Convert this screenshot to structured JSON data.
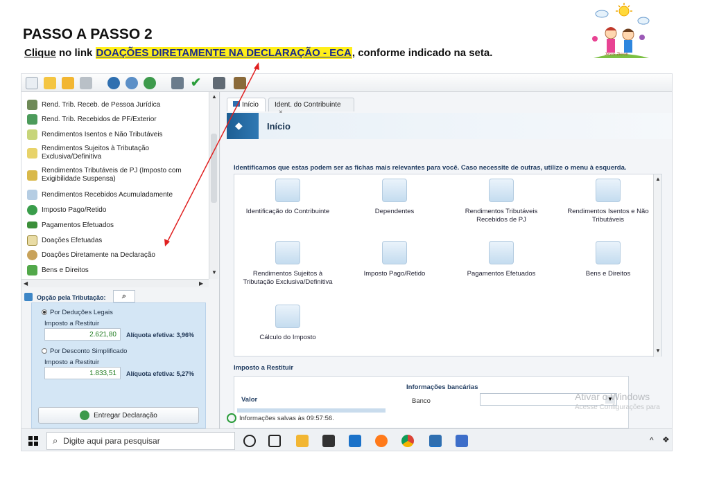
{
  "doc": {
    "title": "PASSO A PASSO 2",
    "instruction_pre": "Clique",
    "instruction_mid": "  no link ",
    "instruction_link": "DOAÇÕES DIRETAMENTE NA DECLARAÇÃO  - ECA",
    "instruction_post": ", conforme indicado na seta."
  },
  "app": {
    "menu_items": [
      "Rend. Trib. Receb. de Pessoa Jurídica",
      "Rend. Trib. Recebidos de PF/Exterior",
      "Rendimentos Isentos e Não Tributáveis",
      "Rendimentos Sujeitos à Tributação Exclusiva/Definitiva",
      "Rendimentos Tributáveis de PJ (Imposto com Exigibilidade Suspensa)",
      "Rendimentos Recebidos Acumuladamente",
      "Imposto Pago/Retido",
      "Pagamentos Efetuados",
      "Doações Efetuadas",
      "Doações Diretamente na Declaração",
      "Bens e Direitos"
    ],
    "opcao_label": "Opção pela Tributação:",
    "deducoes_label": "Por Deduções Legais",
    "imposto_restituir_1": "Imposto a Restituir",
    "valor_1": "2.621,80",
    "aliquota_1": "Alíquota efetiva: 3,96%",
    "simplificado_label": "Por Desconto Simplificado",
    "imposto_restituir_2": "Imposto a Restituir",
    "valor_2": "1.833,51",
    "aliquota_2": "Alíquota efetiva: 5,27%",
    "entregar_label": "Entregar Declaração",
    "tabs": [
      "Início",
      "Ident. do Contribuinte"
    ],
    "tab_close": "×",
    "banner_title": "Início",
    "fichas_msg": "Identificamos que estas podem ser as fichas mais relevantes para você. Caso necessite de outras, utilize o menu à esquerda.",
    "cards": [
      "Identificação do Contribuinte",
      "Dependentes",
      "Rendimentos Tributáveis Recebidos de PJ",
      "Rendimentos Isentos e Não Tributáveis",
      "Rendimentos Sujeitos à Tributação Exclusiva/Definitiva",
      "Imposto Pago/Retido",
      "Pagamentos Efetuados",
      "Bens e Direitos",
      "Cálculo do Imposto"
    ],
    "imposto_label": "Imposto a Restituir",
    "valor_label": "Valor",
    "info_bancarias": "Informações bancárias",
    "banco_label": "Banco",
    "status_text": "Informações salvas às 09:57:56.",
    "watermark": "Ativar o Windows",
    "watermark_sub": "Acesse Configurações para",
    "taskbar_search": "Digite aqui para pesquisar"
  }
}
